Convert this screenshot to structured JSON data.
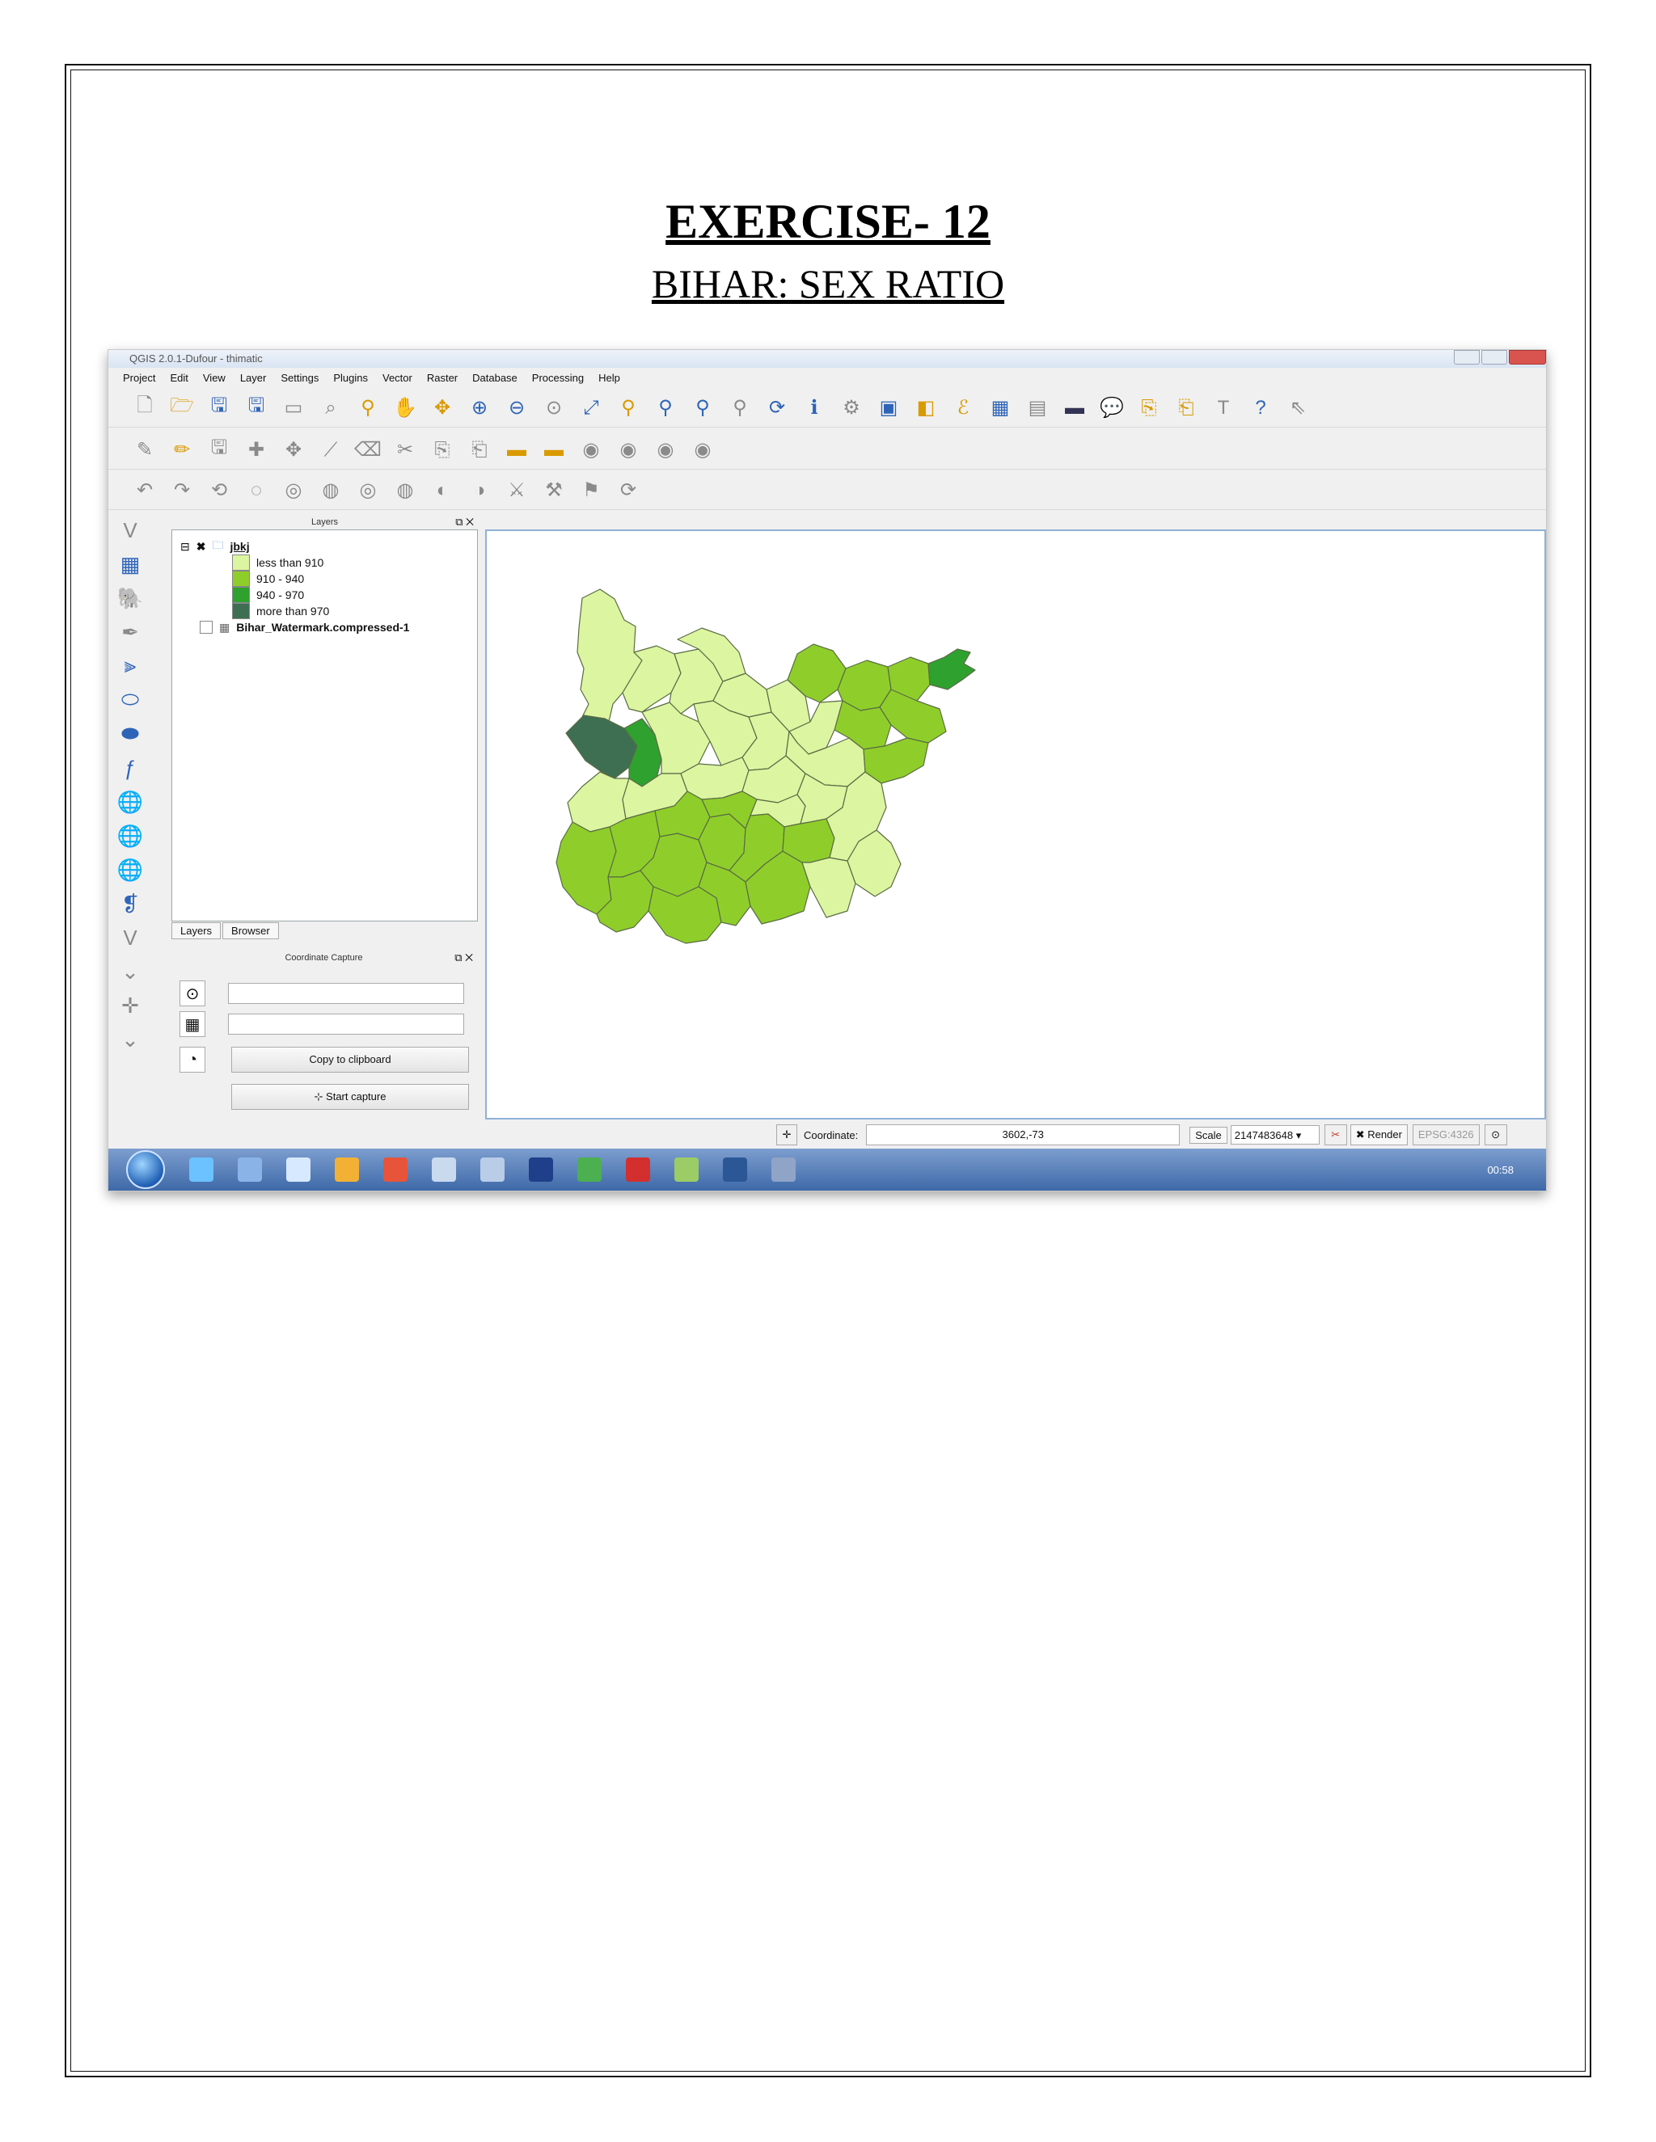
{
  "document": {
    "title": "EXERCISE- 12",
    "subtitle": "BIHAR: SEX RATIO"
  },
  "qgis": {
    "window_title": "QGIS 2.0.1-Dufour - thimatic",
    "menu": [
      "Project",
      "Edit",
      "View",
      "Layer",
      "Settings",
      "Plugins",
      "Vector",
      "Raster",
      "Database",
      "Processing",
      "Help"
    ],
    "layers_panel": {
      "title": "Layers",
      "root_layer": "jbkj",
      "classes": [
        {
          "label": "less than 910",
          "color": "#dcf5a0"
        },
        {
          "label": "910 - 940",
          "color": "#8fce2a"
        },
        {
          "label": "940 - 970",
          "color": "#2fa12f"
        },
        {
          "label": "more than 970",
          "color": "#3e6f52"
        }
      ],
      "raster_layer": "Bihar_Watermark.compressed-1"
    },
    "tabs": [
      "Layers",
      "Browser"
    ],
    "coordinate_capture": {
      "title": "Coordinate Capture",
      "copy_button": "Copy to clipboard",
      "start_button": "Start capture"
    },
    "status": {
      "coordinate_label": "Coordinate:",
      "coordinate_value": "3602,-73",
      "scale_label": "Scale",
      "scale_value": "2147483648",
      "render_label": "Render",
      "crs": "EPSG:4326"
    },
    "clock": "00:58"
  },
  "colors": {
    "class_lt_910": "#dcf5a0",
    "class_910_940": "#8fce2a",
    "class_940_970": "#2fa12f",
    "class_gt_970": "#3e6f52"
  }
}
